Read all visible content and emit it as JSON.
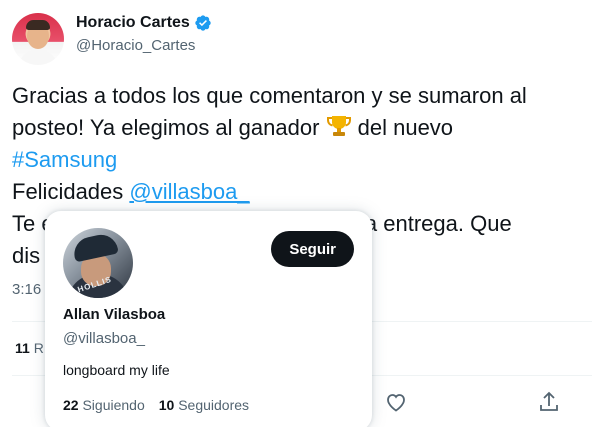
{
  "author": {
    "name": "Horacio Cartes",
    "handle": "@Horacio_Cartes"
  },
  "tweet": {
    "line1": "Gracias a todos los que comentaron y se sumaron al",
    "line2_pre": "posteo! Ya elegimos al ganador ",
    "line2_post": " del nuevo",
    "hashtag": "#Samsung",
    "line4_pre": "Felicidades ",
    "mention": "@villasboa_",
    "line5_left": "Te e",
    "line5_right": "r la entrega. Que",
    "line6_left": "dis",
    "timestamp": "3:16"
  },
  "stats": {
    "retweets_count": "11",
    "retweets_label": "R"
  },
  "hovercard": {
    "follow_label": "Seguir",
    "name": "Allan Vilasboa",
    "handle": "@villasboa_",
    "bio": "longboard my life",
    "following_count": "22",
    "following_label": "Siguiendo",
    "followers_count": "10",
    "followers_label": "Seguidores",
    "avatar_text": "HOLLIS"
  },
  "colors": {
    "link": "#1d9bf0",
    "verified": "#1d9bf0",
    "text": "#0f1419",
    "secondary": "#536471"
  },
  "icons": {
    "verified": "verified-badge-icon",
    "trophy": "trophy-icon",
    "like": "heart-icon",
    "share": "share-icon"
  }
}
